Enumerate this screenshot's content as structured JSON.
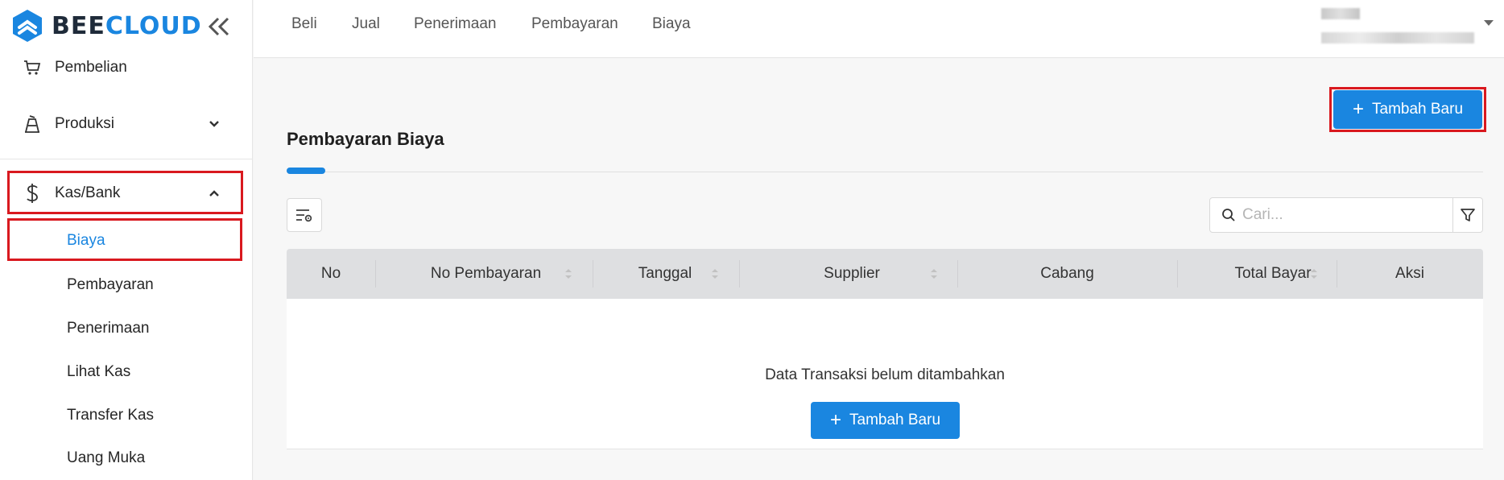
{
  "brand": {
    "part1": "BEE",
    "part2": "CLOUD"
  },
  "sidebar": {
    "items": [
      {
        "label": "Pembelian"
      },
      {
        "label": "Produksi"
      },
      {
        "label": "Kas/Bank"
      }
    ],
    "sub_items": [
      "Biaya",
      "Pembayaran",
      "Penerimaan",
      "Lihat Kas",
      "Transfer Kas",
      "Uang Muka"
    ],
    "active_sub": "Biaya"
  },
  "topnav": [
    "Beli",
    "Jual",
    "Penerimaan",
    "Pembayaran",
    "Biaya"
  ],
  "header": {
    "add_button": "Tambah Baru"
  },
  "page": {
    "title": "Pembayaran Biaya"
  },
  "search": {
    "placeholder": "Cari..."
  },
  "table": {
    "columns": [
      "No",
      "No Pembayaran",
      "Tanggal",
      "Supplier",
      "Cabang",
      "Total Bayar",
      "Aksi"
    ],
    "empty_message": "Data Transaksi belum ditambahkan",
    "empty_button": "Tambah Baru"
  },
  "colors": {
    "accent": "#1a86e0",
    "highlight_border": "#d9191f",
    "header_bg": "#dedfe1"
  },
  "icons": {
    "logo": "beecloud-logo-icon",
    "collapse": "double-chevron-left-icon",
    "pembelian": "cart-icon",
    "produksi": "production-icon",
    "kas": "dollar-icon",
    "settings": "column-settings-icon",
    "search": "search-icon",
    "filter": "filter-icon"
  }
}
